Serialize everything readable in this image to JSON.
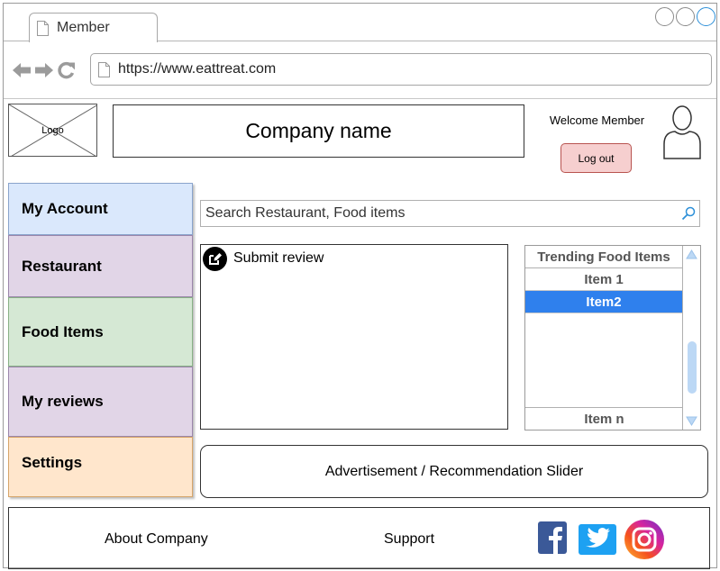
{
  "browser": {
    "tab_title": "Member",
    "url": "https://www.eattreat.com"
  },
  "header": {
    "logo_text": "Logo",
    "company_name": "Company name",
    "welcome_text": "Welcome Member",
    "logout_label": "Log out"
  },
  "sidebar": {
    "items": [
      {
        "label": "My Account",
        "color": "#dae8fc"
      },
      {
        "label": "Restaurant",
        "color": "#e1d5e7"
      },
      {
        "label": "Food Items",
        "color": "#d5e8d4"
      },
      {
        "label": "My reviews",
        "color": "#e1d5e7"
      },
      {
        "label": "Settings",
        "color": "#ffe6cc"
      }
    ]
  },
  "search": {
    "placeholder": "Search Restaurant, Food items"
  },
  "review": {
    "label": "Submit review"
  },
  "trending": {
    "title": "Trending Food Items",
    "items": [
      "Item 1",
      "Item2"
    ],
    "selected_index": 1,
    "last_item": "Item n"
  },
  "ad_slider": {
    "label": "Advertisement / Recommendation Slider"
  },
  "footer": {
    "about": "About Company",
    "support": "Support"
  },
  "colors": {
    "accent": "#2f80ed",
    "logout_bg": "#f6cfcf"
  }
}
